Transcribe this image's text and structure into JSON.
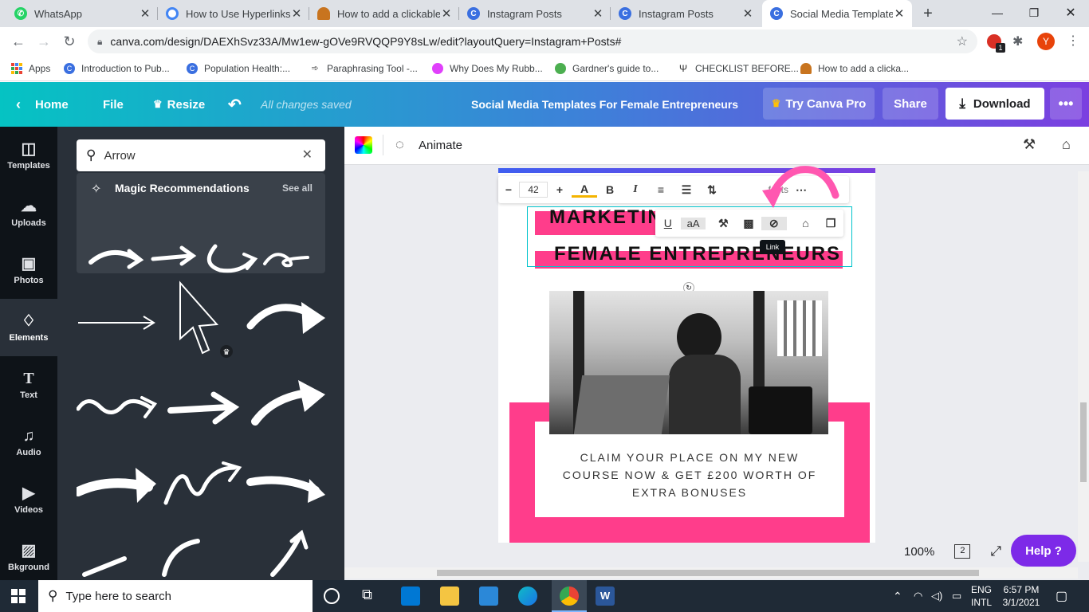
{
  "browser": {
    "tabs": [
      {
        "label": "WhatsApp",
        "icon": "whatsapp-icon",
        "color": "#25d366"
      },
      {
        "label": "How to Use Hyperlinks",
        "icon": "google-icon",
        "color": "#4285f4"
      },
      {
        "label": "How to add a clickable",
        "icon": "site-icon",
        "color": "#c8741f"
      },
      {
        "label": "Instagram Posts",
        "icon": "canva-icon",
        "color": "#3a6fe0"
      },
      {
        "label": "Instagram Posts",
        "icon": "canva-icon",
        "color": "#3a6fe0"
      },
      {
        "label": "Social Media Templates",
        "icon": "canva-icon",
        "color": "#3a6fe0"
      }
    ],
    "new_tab": "+",
    "url": "canva.com/design/DAEXhSvz33A/Mw1ew-gOVe9RVQQP9Y8sLw/edit?layoutQuery=Instagram+Posts#",
    "profile_initial": "Y",
    "extension_badge": "1",
    "bookmarks": [
      "Apps",
      "Introduction to Pub...",
      "Population Health:...",
      "Paraphrasing Tool -...",
      "Why Does My Rubb...",
      "Gardner's guide to...",
      "CHECKLIST BEFORE...",
      "How to add a clicka..."
    ]
  },
  "canva": {
    "home": "Home",
    "file": "File",
    "resize": "Resize",
    "saved_status": "All changes saved",
    "design_title": "Social Media Templates For Female Entrepreneurs",
    "try_pro": "Try Canva Pro",
    "share": "Share",
    "download": "Download",
    "brand_color": "#7d2ae8"
  },
  "rail": [
    {
      "label": "Templates",
      "icon": "templates-icon"
    },
    {
      "label": "Uploads",
      "icon": "uploads-icon"
    },
    {
      "label": "Photos",
      "icon": "photos-icon"
    },
    {
      "label": "Elements",
      "icon": "elements-icon",
      "active": true
    },
    {
      "label": "Text",
      "icon": "text-icon"
    },
    {
      "label": "Audio",
      "icon": "audio-icon"
    },
    {
      "label": "Videos",
      "icon": "videos-icon"
    },
    {
      "label": "Bkground",
      "icon": "background-icon"
    }
  ],
  "panel": {
    "search_value": "Arrow",
    "magic_title": "Magic Recommendations",
    "see_all": "See all"
  },
  "editor": {
    "animate": "Animate",
    "font_size": "42",
    "effects_label": "fects",
    "tooltip": "Link",
    "design_text": {
      "line1": "MARKETIN",
      "line2": "FEMALE ENTREPRENEURS",
      "body": [
        "CLAIM YOUR PLACE ON MY NEW",
        "COURSE NOW & GET £200 WORTH OF",
        "EXTRA BONUSES"
      ]
    },
    "accent_pink": "#ff3d8b",
    "zoom": "100%",
    "page_count": "2",
    "help": "Help ?"
  },
  "taskbar": {
    "search_placeholder": "Type here to search",
    "language": "ENG",
    "layout": "INTL",
    "time": "6:57 PM",
    "date": "3/1/2021"
  }
}
